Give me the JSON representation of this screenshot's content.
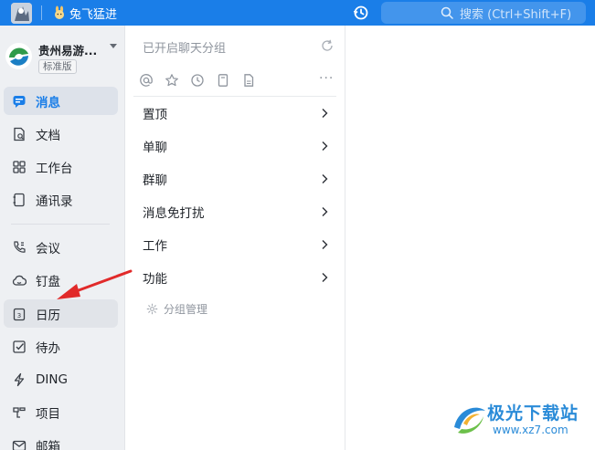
{
  "topbar": {
    "user_name": "兔飞猛进",
    "search_placeholder": "搜索 (Ctrl+Shift+F)",
    "bg_color": "#1a7ee8",
    "icons": [
      "app-logo",
      "rabbit-avatar-icon",
      "history-clock-icon",
      "search-icon"
    ]
  },
  "sidebar": {
    "org_name": "贵州易游...",
    "org_badge": "标准版",
    "items": [
      {
        "label": "消息",
        "icon": "message-icon",
        "active": true
      },
      {
        "label": "文档",
        "icon": "document-icon"
      },
      {
        "label": "工作台",
        "icon": "workbench-grid-icon"
      },
      {
        "label": "通讯录",
        "icon": "contacts-book-icon"
      },
      {
        "label": "会议",
        "icon": "phone-video-icon"
      },
      {
        "label": "钉盘",
        "icon": "cloud-drive-icon"
      },
      {
        "label": "日历",
        "icon": "calendar-icon",
        "hovered": true
      },
      {
        "label": "待办",
        "icon": "todo-check-icon"
      },
      {
        "label": "DING",
        "icon": "ding-bolt-icon"
      },
      {
        "label": "项目",
        "icon": "project-icon"
      },
      {
        "label": "邮箱",
        "icon": "mail-icon"
      }
    ],
    "accent_color": "#1a7ee8"
  },
  "middle": {
    "title": "已开启聊天分组",
    "filters": [
      "at-mention-icon",
      "star-icon",
      "recent-clock-icon",
      "bookmark-icon",
      "file-icon",
      "more-icon"
    ],
    "more_label": "···",
    "groups": [
      {
        "label": "置顶"
      },
      {
        "label": "单聊"
      },
      {
        "label": "群聊"
      },
      {
        "label": "消息免打扰"
      },
      {
        "label": "工作"
      },
      {
        "label": "功能"
      }
    ],
    "manage_label": "分组管理"
  },
  "watermark": {
    "title": "极光下载站",
    "url": "www.xz7.com"
  }
}
